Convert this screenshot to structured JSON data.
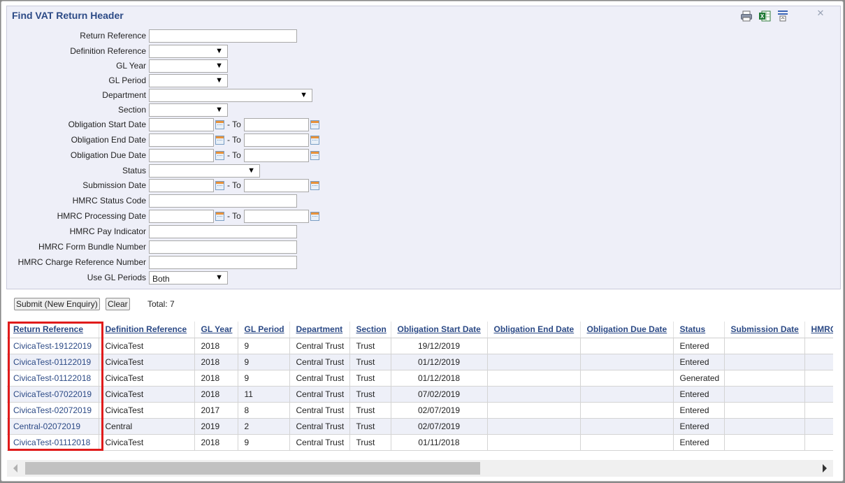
{
  "window": {
    "title": "Find VAT Return Header",
    "close_glyph": "✕"
  },
  "toolbar": {
    "icons": [
      "printer-icon",
      "excel-export-icon",
      "column-settings-icon"
    ]
  },
  "form": {
    "return_reference": {
      "label": "Return Reference",
      "value": ""
    },
    "definition_reference": {
      "label": "Definition Reference",
      "value": ""
    },
    "gl_year": {
      "label": "GL Year",
      "value": ""
    },
    "gl_period": {
      "label": "GL Period",
      "value": ""
    },
    "department": {
      "label": "Department",
      "value": ""
    },
    "section": {
      "label": "Section",
      "value": ""
    },
    "obligation_start_date": {
      "label": "Obligation Start Date",
      "to": "- To"
    },
    "obligation_end_date": {
      "label": "Obligation End Date",
      "to": "- To"
    },
    "obligation_due_date": {
      "label": "Obligation Due Date",
      "to": "- To"
    },
    "status": {
      "label": "Status",
      "value": ""
    },
    "submission_date": {
      "label": "Submission Date",
      "to": "- To"
    },
    "hmrc_status_code": {
      "label": "HMRC Status Code",
      "value": ""
    },
    "hmrc_processing_date": {
      "label": "HMRC Processing Date",
      "to": "- To"
    },
    "hmrc_pay_indicator": {
      "label": "HMRC Pay Indicator",
      "value": ""
    },
    "hmrc_form_bundle_number": {
      "label": "HMRC Form Bundle Number",
      "value": ""
    },
    "hmrc_charge_reference_number": {
      "label": "HMRC Charge Reference Number",
      "value": ""
    },
    "use_gl_periods": {
      "label": "Use GL Periods",
      "value": "Both"
    },
    "dropdown_arrow": "▼"
  },
  "actions": {
    "submit_label": "Submit (New Enquiry)",
    "clear_label": "Clear",
    "total_text": "Total: 7"
  },
  "grid": {
    "columns": [
      "Return Reference",
      "Definition Reference",
      "GL Year",
      "GL Period",
      "Department",
      "Section",
      "Obligation Start Date",
      "Obligation End Date",
      "Obligation Due Date",
      "Status",
      "Submission Date",
      "HMRC"
    ],
    "rows": [
      [
        "CivicaTest-19122019",
        "CivicaTest",
        "2018",
        "9",
        "Central Trust",
        "Trust",
        "19/12/2019",
        "",
        "",
        "Entered",
        "",
        ""
      ],
      [
        "CivicaTest-01122019",
        "CivicaTest",
        "2018",
        "9",
        "Central Trust",
        "Trust",
        "01/12/2019",
        "",
        "",
        "Entered",
        "",
        ""
      ],
      [
        "CivicaTest-01122018",
        "CivicaTest",
        "2018",
        "9",
        "Central Trust",
        "Trust",
        "01/12/2018",
        "",
        "",
        "Generated",
        "",
        ""
      ],
      [
        "CivicaTest-07022019",
        "CivicaTest",
        "2018",
        "11",
        "Central Trust",
        "Trust",
        "07/02/2019",
        "",
        "",
        "Entered",
        "",
        ""
      ],
      [
        "CivicaTest-02072019",
        "CivicaTest",
        "2017",
        "8",
        "Central Trust",
        "Trust",
        "02/07/2019",
        "",
        "",
        "Entered",
        "",
        ""
      ],
      [
        "Central-02072019",
        "Central",
        "2019",
        "2",
        "Central Trust",
        "Trust",
        "02/07/2019",
        "",
        "",
        "Entered",
        "",
        ""
      ],
      [
        "CivicaTest-01112018",
        "CivicaTest",
        "2018",
        "9",
        "Central Trust",
        "Trust",
        "01/11/2018",
        "",
        "",
        "Entered",
        "",
        ""
      ]
    ]
  },
  "colors": {
    "accent": "#2c4a86",
    "highlight": "#e01b1b",
    "panel_bg": "#eeeff8"
  }
}
